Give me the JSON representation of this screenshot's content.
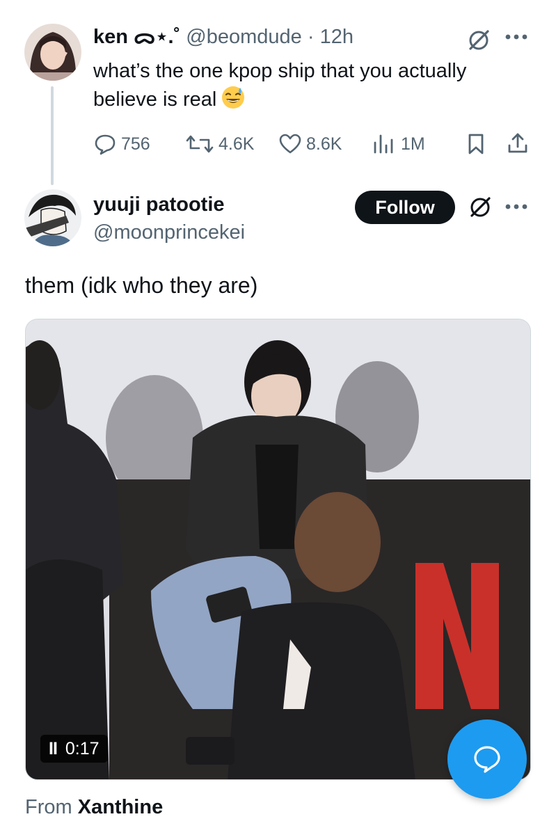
{
  "original_post": {
    "author_name": "ken ᯅ⋆.˚",
    "author_handle": "@beomdude",
    "separator": "·",
    "time": "12h",
    "text": "what’s the one kpop ship that you actually believe is real",
    "emoji": "sweat-smile",
    "stats": {
      "replies": "756",
      "reposts": "4.6K",
      "likes": "8.6K",
      "views": "1M"
    }
  },
  "reply": {
    "author_name": "yuuji patootie",
    "author_handle": "@moonprincekei",
    "follow_label": "Follow",
    "text": "them (idk who they are)",
    "video": {
      "timestamp": "0:17",
      "pause_glyph": "II"
    },
    "source_prefix": "From",
    "source_name": "Xanthine"
  },
  "colors": {
    "text_primary": "#0f1419",
    "text_secondary": "#536471",
    "accent_blue": "#1d9bf0",
    "follow_bg": "#0f1419"
  }
}
